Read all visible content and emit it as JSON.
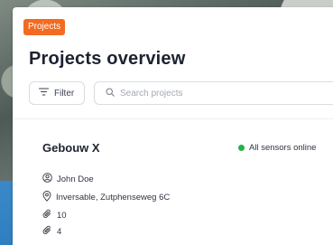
{
  "breadcrumb": {
    "label": "Projects"
  },
  "page": {
    "title": "Projects overview"
  },
  "toolbar": {
    "filter_label": "Filter",
    "search_placeholder": "Search projects"
  },
  "projects": [
    {
      "name": "Gebouw X",
      "status": "All sensors online",
      "status_color": "#22b14c",
      "owner": "John Doe",
      "address": "Inversable, Zutphenseweg 6C",
      "count_a": "10",
      "count_b": "4"
    }
  ],
  "colors": {
    "accent": "#f26b21",
    "status_online": "#22b14c"
  }
}
